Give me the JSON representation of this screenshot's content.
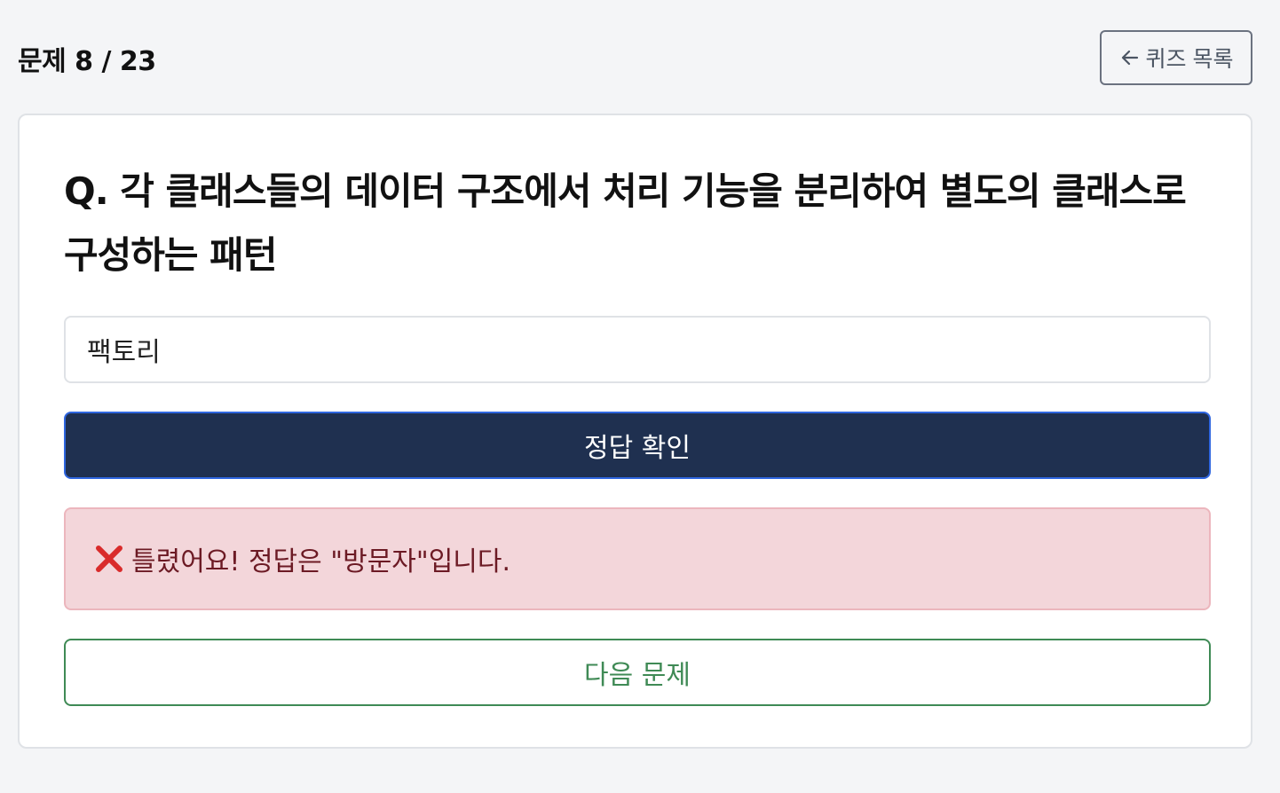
{
  "header": {
    "progress": "문제 8 / 23",
    "back_label": "퀴즈 목록",
    "back_icon": "arrow-left-icon"
  },
  "quiz": {
    "question": "Q. 각 클래스들의 데이터 구조에서 처리 기능을 분리하여 별도의 클래스로 구성하는 패턴",
    "answer_value": "팩토리",
    "check_label": "정답 확인",
    "result_icon": "cross-mark-icon",
    "result_message": "틀렸어요! 정답은 \"방문자\"입니다.",
    "next_label": "다음 문제"
  },
  "colors": {
    "background": "#f4f5f7",
    "primary_button": "#1f3050",
    "error_bg": "#f3d6da",
    "error_text": "#6c1a24",
    "error_icon": "#d92b2b",
    "success_outline": "#3f8a55"
  }
}
